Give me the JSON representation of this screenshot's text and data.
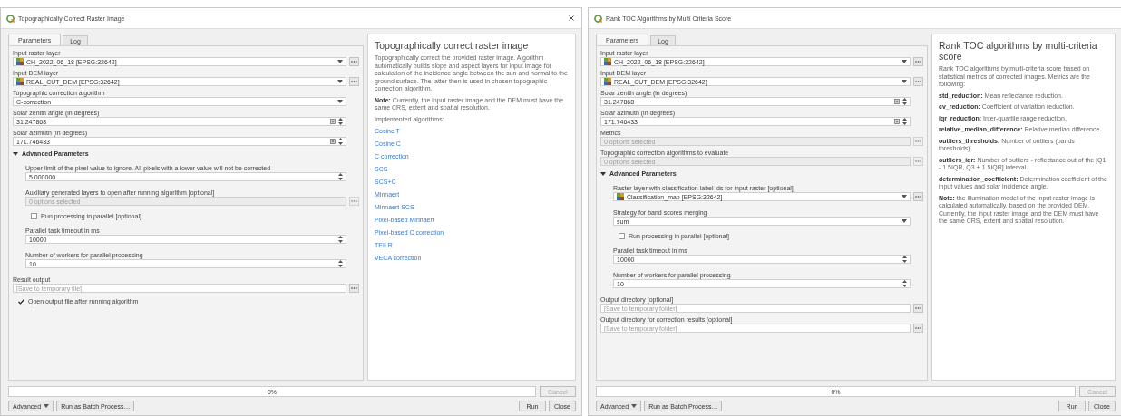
{
  "windows": [
    {
      "title": "Topographically Correct Raster Image",
      "closable": true,
      "tabs": [
        {
          "label": "Parameters",
          "selected": true
        },
        {
          "label": "Log",
          "selected": false
        }
      ],
      "parameters": [
        {
          "kind": "layer",
          "label": "Input raster layer",
          "value": "CH_2022_06_18 [EPSG:32642]"
        },
        {
          "kind": "layer",
          "label": "Input DEM layer",
          "value": "REAL_CUT_DEM [EPSG:32642]"
        },
        {
          "kind": "combo",
          "label": "Topographic correction algorithm",
          "value": "C-correction"
        },
        {
          "kind": "number",
          "label": "Solar zenith angle (in degrees)",
          "value": "31.247868"
        },
        {
          "kind": "number",
          "label": "Solar azimuth (in degrees)",
          "value": "171.746433"
        },
        {
          "kind": "section",
          "label": "Advanced Parameters",
          "expanded": true,
          "children": [
            {
              "kind": "spin",
              "label": "Upper limit of the pixel value to ignore. All pixels with a lower value will not be corrected",
              "value": "5.000000"
            },
            {
              "kind": "multi",
              "label": "Auxiliary generated layers to open after running algorithm [optional]",
              "placeholder": "0 options selected",
              "disabled": true
            },
            {
              "kind": "checkbox",
              "label": "Run processing in parallel [optional]",
              "checked": false
            },
            {
              "kind": "spin",
              "label": "Parallel task timeout in ms",
              "value": "10000"
            },
            {
              "kind": "spin",
              "label": "Number of workers for parallel processing",
              "value": "10"
            }
          ]
        },
        {
          "kind": "file",
          "label": "Result output",
          "placeholder": "[Save to temporary file]"
        },
        {
          "kind": "checkbox",
          "label": "Open output file after running algorithm",
          "checked": true
        }
      ],
      "help": [
        {
          "kind": "heading",
          "text": "Topographically correct raster image"
        },
        {
          "kind": "para",
          "text": "Topographically correct the provided raster image. Algorithm automatically builds slope and aspect layers for input image for calculation of the incidence angle between the sun and normal to the ground surface. The latter then is used in chosen topographic correction algorithm."
        },
        {
          "kind": "para",
          "text": "**Note:** Currently, the input raster image and the DEM must have the same CRS, extent and spatial resolution."
        },
        {
          "kind": "para",
          "text": "Implemented algorithms:"
        },
        {
          "kind": "link",
          "text": "Cosine T"
        },
        {
          "kind": "link",
          "text": "Cosine C"
        },
        {
          "kind": "link",
          "text": "C correction"
        },
        {
          "kind": "link",
          "text": "SCS"
        },
        {
          "kind": "link",
          "text": "SCS+C"
        },
        {
          "kind": "link",
          "text": "Minnaert"
        },
        {
          "kind": "link",
          "text": "Minnaert SCS"
        },
        {
          "kind": "link",
          "text": "Pixel-based Minnaert"
        },
        {
          "kind": "link",
          "text": "Pixel-based C correction"
        },
        {
          "kind": "link",
          "text": "TEILR"
        },
        {
          "kind": "link",
          "text": "VECA correction"
        }
      ],
      "progress": "0%",
      "level": 0,
      "cancel": "Cancel",
      "advanced": "Advanced",
      "batch": "Run as Batch Process…",
      "run": "Run",
      "close": "Close"
    },
    {
      "title": "Rank TOC Algorithms by Multi Criteria Score",
      "closable": false,
      "tabs": [
        {
          "label": "Parameters",
          "selected": true
        },
        {
          "label": "Log",
          "selected": false
        }
      ],
      "parameters": [
        {
          "kind": "layer",
          "label": "Input raster layer",
          "value": "CH_2022_06_18 [EPSG:32642]"
        },
        {
          "kind": "layer",
          "label": "Input DEM layer",
          "value": "REAL_CUT_DEM [EPSG:32642]"
        },
        {
          "kind": "number",
          "label": "Solar zenith angle (in degrees)",
          "value": "31.247868"
        },
        {
          "kind": "number",
          "label": "Solar azimuth (in degrees)",
          "value": "171.746433"
        },
        {
          "kind": "multi",
          "label": "Metrics",
          "placeholder": "0 options selected",
          "disabled": true
        },
        {
          "kind": "multi",
          "label": "Topographic correction algorithms to evaluate",
          "placeholder": "0 options selected",
          "disabled": true
        },
        {
          "kind": "section",
          "label": "Advanced Parameters",
          "expanded": true,
          "children": [
            {
              "kind": "layer",
              "label": "Raster layer with classification label ids for input raster [optional]",
              "value": "Classification_map [EPSG:32642]"
            },
            {
              "kind": "combo",
              "label": "Strategy for band scores merging",
              "value": "sum"
            },
            {
              "kind": "checkbox",
              "label": "Run processing in parallel [optional]",
              "checked": false
            },
            {
              "kind": "spin",
              "label": "Parallel task timeout in ms",
              "value": "10000"
            },
            {
              "kind": "spin",
              "label": "Number of workers for parallel processing",
              "value": "10"
            }
          ]
        },
        {
          "kind": "file",
          "label": "Output directory [optional]",
          "placeholder": "[Save to temporary folder]"
        },
        {
          "kind": "file",
          "label": "Output directory for correction results [optional]",
          "placeholder": "[Save to temporary folder]"
        }
      ],
      "help": [
        {
          "kind": "heading",
          "text": "Rank TOC algorithms by multi-criteria score"
        },
        {
          "kind": "para",
          "text": "Rank TOC algorithms by multi-criteria score based on statistical metrics of corrected images. Metrics are the following:"
        },
        {
          "kind": "para",
          "text": "**std_reduction:** Mean reflectance reduction."
        },
        {
          "kind": "para",
          "text": "**cv_reduction:** Coefficient of variation reduction."
        },
        {
          "kind": "para",
          "text": "**iqr_reduction:** Inter-quartile range reduction."
        },
        {
          "kind": "para",
          "text": "**relative_median_difference:** Relative median difference."
        },
        {
          "kind": "para",
          "text": "**outliers_thresholds:** Number of outliers (bands thresholds)."
        },
        {
          "kind": "para",
          "text": "**outliers_iqr:** Number of outliers - reflectance out of the [Q1 - 1.5IQR, Q3 + 1.5IQR] interval."
        },
        {
          "kind": "para",
          "text": "**determination_coefficient:** Determination coefficient of the input values and solar incidence angle."
        },
        {
          "kind": "para",
          "text": "**Note:** the illumination model of the input raster image is calculated automatically, based on the provided DEM. Currently, the input raster image and the DEM must have the same CRS, extent and spatial resolution."
        }
      ],
      "progress": "0%",
      "level": 0,
      "cancel": "Cancel",
      "advanced": "Advanced",
      "batch": "Run as Batch Process…",
      "run": "Run",
      "close": "Close"
    }
  ]
}
